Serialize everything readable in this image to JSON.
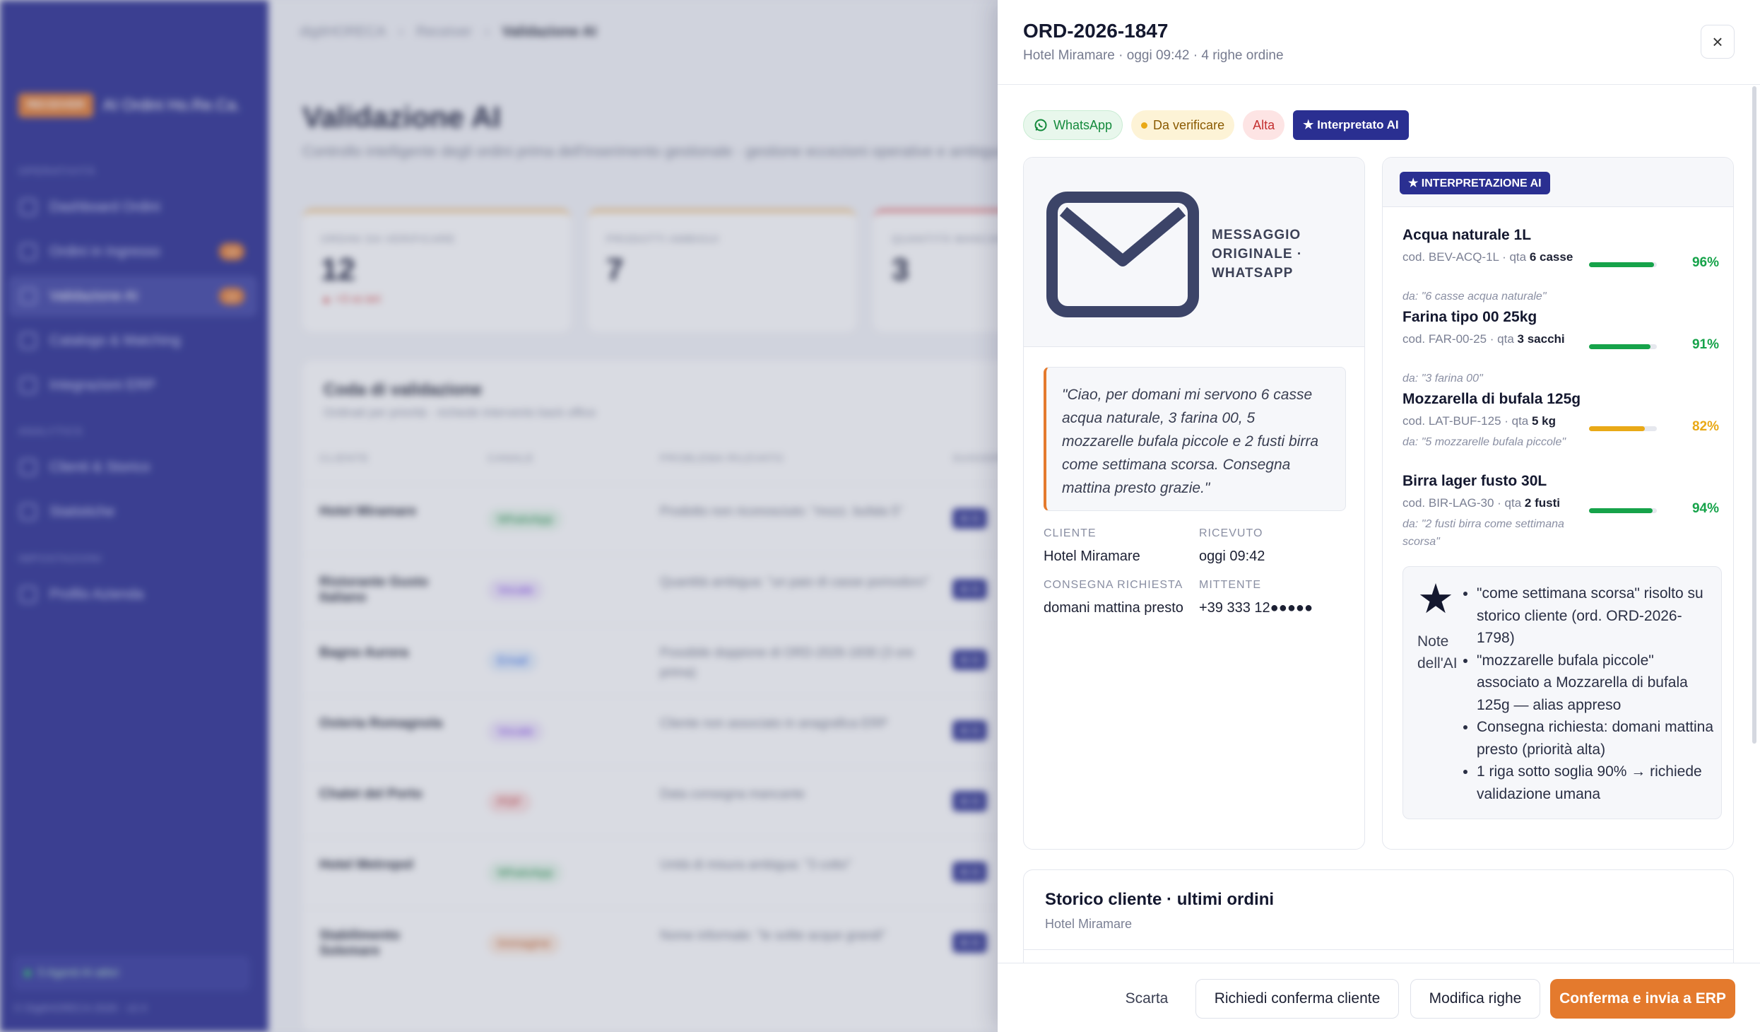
{
  "app": {
    "brand_tag": "RECEIVER",
    "brand_name": "AI Ordini Ho.Re.Ca.",
    "sections": {
      "operativita": "OPERATIVITÀ",
      "analytics": "ANALYTICS",
      "impostazioni": "IMPOSTAZIONI"
    },
    "nav": [
      {
        "label": "Dashboard Ordini",
        "badge": ""
      },
      {
        "label": "Ordini in Ingresso",
        "badge": "14"
      },
      {
        "label": "Validazione AI",
        "badge": "12"
      },
      {
        "label": "Catalogo & Matching",
        "badge": ""
      },
      {
        "label": "Integrazioni ERP",
        "badge": ""
      },
      {
        "label": "Clienti & Storico",
        "badge": ""
      },
      {
        "label": "Statistiche",
        "badge": ""
      },
      {
        "label": "Profilo Azienda",
        "badge": ""
      }
    ],
    "agents": "5 Agenti AI attivi",
    "footer": "© DigitHORECA 2026 · v2.4",
    "breadcrumb": [
      "digitHORECA",
      "Receiver",
      "Validazione AI"
    ],
    "page_title": "Validazione AI",
    "page_subtitle": "Controllo intelligente degli ordini prima dell'inserimento gestionale · gestione eccezioni operative e ambigui",
    "kpis": [
      {
        "label": "ORDINI DA VERIFICARE",
        "value": "12",
        "delta": "▲ +3 vs ieri"
      },
      {
        "label": "PRODOTTI AMBIGUI",
        "value": "7",
        "delta": ""
      },
      {
        "label": "QUANTITÀ MANCANTI",
        "value": "3",
        "delta": ""
      }
    ],
    "queue": {
      "title": "Coda di validazione",
      "subtitle": "Ordinati per priorità · richiede intervento back office",
      "headers": [
        "CLIENTE",
        "CANALE",
        "PROBLEMA RILEVATO",
        "SUGGERIMENTO"
      ],
      "rows": [
        {
          "cliente": "Hotel Miramare",
          "canale": "WhatsApp",
          "problema": "Prodotto non riconosciuto: \"mozz. bufala 5\"",
          "ai": "★ AI"
        },
        {
          "cliente": "Ristorante Gusto Italiano",
          "canale": "Vocale",
          "problema": "Quantità ambigua: \"un paio di casse pomodoro\"",
          "ai": "★ AI"
        },
        {
          "cliente": "Bagno Aurora",
          "canale": "Email",
          "problema": "Possibile doppione di ORD-2026-1830 (3 ore prima)",
          "ai": "★ AI"
        },
        {
          "cliente": "Osteria Romagnola",
          "canale": "Vocale",
          "problema": "Cliente non associato in anagrafica ERP",
          "ai": "★ AI"
        },
        {
          "cliente": "Chalet del Porto",
          "canale": "PDF",
          "problema": "Data consegna mancante",
          "ai": "★ AI"
        },
        {
          "cliente": "Hotel Metropol",
          "canale": "WhatsApp",
          "problema": "Unità di misura ambigua: \"3 cotto\"",
          "ai": "★ AI"
        },
        {
          "cliente": "Stabilimento Solemare",
          "canale": "Immagine",
          "problema": "Nome informale: \"le solite acque grandi\"",
          "ai": "★ AI"
        }
      ]
    }
  },
  "drawer": {
    "title": "ORD-2026-1847",
    "subtitle": "Hotel Miramare · oggi 09:42 · 4 righe ordine",
    "close_icon": "×",
    "chips": {
      "channel": "WhatsApp",
      "status": "Da verificare",
      "priority": "Alta",
      "ai": "★ Interpretato AI"
    },
    "message": {
      "header": "MESSAGGIO ORIGINALE · WHATSAPP",
      "text": "\"Ciao, per domani mi servono 6 casse acqua naturale, 3 farina 00, 5 mozzarelle bufala piccole e 2 fusti birra come settimana scorsa. Consegna mattina presto grazie.\"",
      "cliente_label": "CLIENTE",
      "cliente": "Hotel Miramare",
      "ricevuto_label": "RICEVUTO",
      "ricevuto": "oggi 09:42",
      "consegna_label": "CONSEGNA RICHIESTA",
      "consegna": "domani mattina presto",
      "mittente_label": "MITTENTE",
      "mittente": "+39 333 12●●●●●"
    },
    "interpretation": {
      "badge": "★ INTERPRETAZIONE AI",
      "items": [
        {
          "name": "Acqua naturale 1L",
          "code": "cod. BEV-ACQ-1L · qta ",
          "qty": "6 casse",
          "from": "da: \"6 casse acqua naturale\"",
          "confidence": 96,
          "pct": "96%",
          "color": "#16a34a"
        },
        {
          "name": "Farina tipo 00 25kg",
          "code": "cod. FAR-00-25 · qta ",
          "qty": "3 sacchi",
          "from": "da: \"3 farina 00\"",
          "confidence": 91,
          "pct": "91%",
          "color": "#16a34a"
        },
        {
          "name": "Mozzarella di bufala 125g",
          "code": "cod. LAT-BUF-125 · qta ",
          "qty": "5 kg",
          "from": "da: \"5 mozzarelle bufala piccole\"",
          "confidence": 82,
          "pct": "82%",
          "color": "#e9a917"
        },
        {
          "name": "Birra lager fusto 30L",
          "code": "cod. BIR-LAG-30 · qta ",
          "qty": "2 fusti",
          "from": "da: \"2 fusti birra come settimana scorsa\"",
          "confidence": 94,
          "pct": "94%",
          "color": "#16a34a"
        }
      ],
      "notes_icon": "★",
      "notes_label": "Note dell'AI",
      "notes": [
        "\"come settimana scorsa\" risolto su storico cliente (ord. ORD-2026-1798)",
        "\"mozzarelle bufala piccole\" associato a Mozzarella di bufala 125g — alias appreso",
        "Consegna richiesta: domani mattina presto (priorità alta)",
        "1 riga sotto soglia 90% → richiede validazione umana"
      ]
    },
    "history": {
      "title": "Storico cliente · ultimi ordini",
      "subtitle": "Hotel Miramare"
    },
    "footer": {
      "discard": "Scarta",
      "ask_confirm": "Richiedi conferma cliente",
      "edit_rows": "Modifica righe",
      "confirm": "Conferma e invia a ERP"
    }
  }
}
